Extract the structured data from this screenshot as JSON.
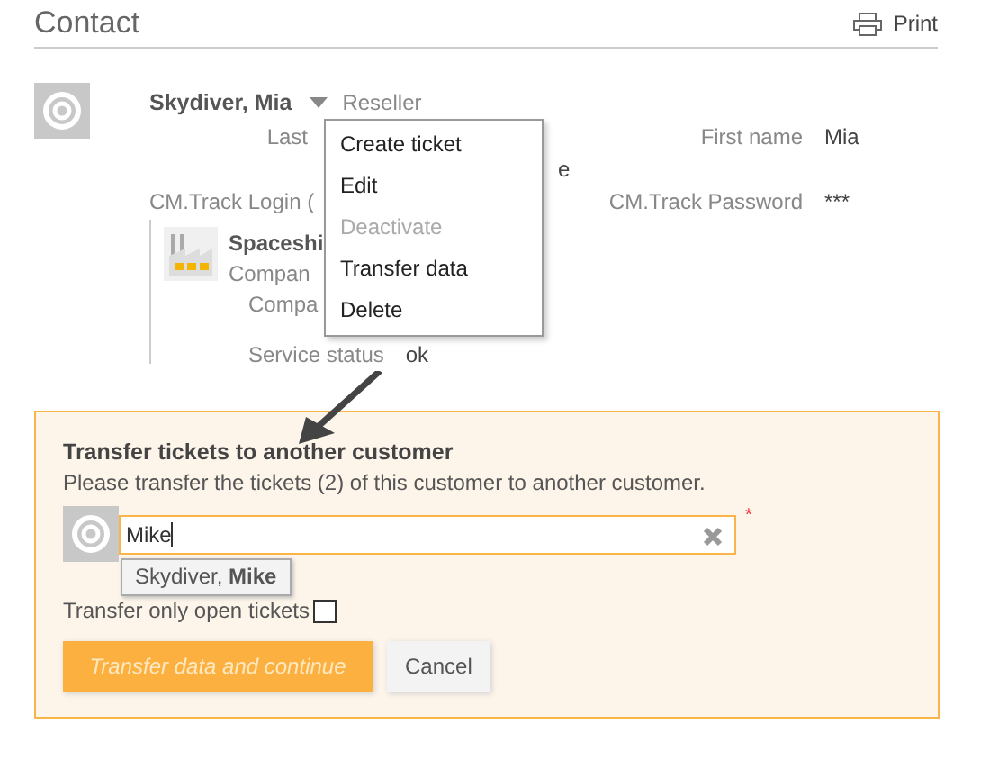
{
  "header": {
    "title": "Contact",
    "print_label": "Print"
  },
  "contact": {
    "name": "Skydiver, Mia",
    "role": "Reseller",
    "last_name_label": "Last",
    "partial_value": "e",
    "first_name_label": "First name",
    "first_name": "Mia",
    "login_label": "CM.Track Login (",
    "password_label": "CM.Track Password",
    "password": "***",
    "company": {
      "name": "Spaceshi",
      "line_1": "Compan",
      "line_2": "Compa",
      "status_label": "Service status",
      "status": "ok"
    }
  },
  "menu": {
    "items": [
      {
        "label": "Create ticket",
        "disabled": false
      },
      {
        "label": "Edit",
        "disabled": false
      },
      {
        "label": "Deactivate",
        "disabled": true
      },
      {
        "label": "Transfer data",
        "disabled": false
      },
      {
        "label": "Delete",
        "disabled": false
      }
    ]
  },
  "transfer": {
    "heading": "Transfer tickets to another customer",
    "text": "Please transfer the tickets (2) of this customer to another customer.",
    "value": "Mike",
    "required_mark": "*",
    "suggestions": [
      {
        "label": "Skydiver, **Mike**"
      }
    ],
    "open_only_label": "Transfer only open tickets",
    "open_only_checked": false,
    "buttons": [
      {
        "label": "Transfer data and continue",
        "kind": "primary"
      },
      {
        "label": "Cancel",
        "kind": "secondary"
      }
    ]
  }
}
